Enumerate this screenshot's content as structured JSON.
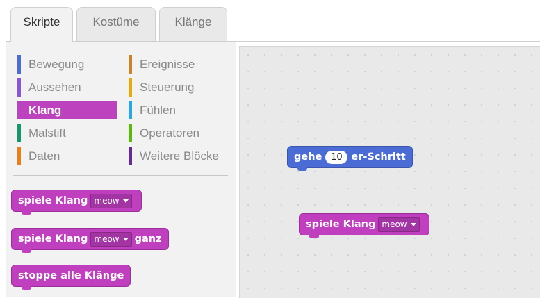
{
  "tabs": [
    {
      "label": "Skripte",
      "active": true
    },
    {
      "label": "Kostüme",
      "active": false
    },
    {
      "label": "Klänge",
      "active": false
    }
  ],
  "categories": [
    {
      "label": "Bewegung",
      "color": "#4a6cd4"
    },
    {
      "label": "Aussehen",
      "color": "#8a55d7"
    },
    {
      "label": "Klang",
      "color": "#bb42c3",
      "active": true
    },
    {
      "label": "Malstift",
      "color": "#0e9a6c"
    },
    {
      "label": "Daten",
      "color": "#ee7d16"
    },
    {
      "label": "Ereignisse",
      "color": "#c88330"
    },
    {
      "label": "Steuerung",
      "color": "#e1a91a"
    },
    {
      "label": "Fühlen",
      "color": "#2ca5e2"
    },
    {
      "label": "Operatoren",
      "color": "#5cb712"
    },
    {
      "label": "Weitere Blöcke",
      "color": "#632d99"
    }
  ],
  "palette_blocks": {
    "play_sound": {
      "label": "spiele Klang",
      "sound": "meow"
    },
    "play_sound_until_done": {
      "label": "spiele Klang",
      "sound": "meow",
      "suffix": "ganz"
    },
    "stop_all_sounds": {
      "label": "stoppe alle Klänge"
    }
  },
  "script_blocks": {
    "move": {
      "label": "gehe",
      "value": "10",
      "suffix": "er-Schritt"
    },
    "play_sound": {
      "label": "spiele Klang",
      "sound": "meow"
    }
  },
  "colors": {
    "sound_block": "#bf3fbf",
    "motion_block": "#4a6cd4"
  }
}
